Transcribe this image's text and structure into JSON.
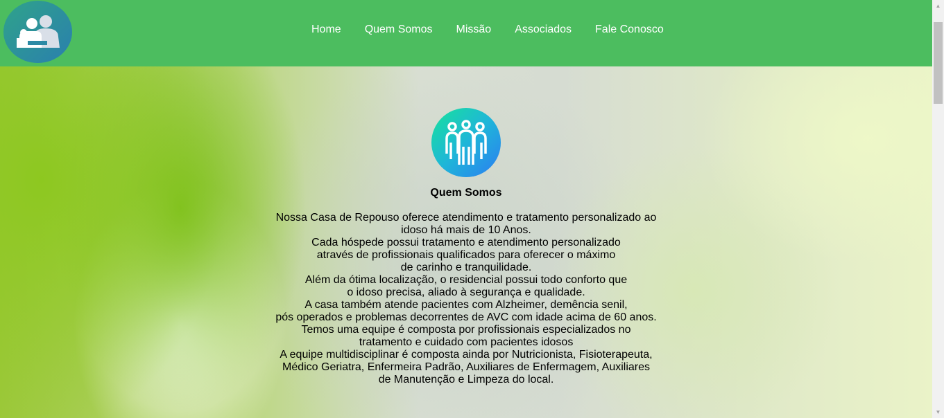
{
  "nav": {
    "items": [
      {
        "label": "Home"
      },
      {
        "label": "Quem Somos"
      },
      {
        "label": "Missão"
      },
      {
        "label": "Associados"
      },
      {
        "label": "Fale Conosco"
      }
    ]
  },
  "section": {
    "title": "Quem Somos",
    "lines": [
      "Nossa Casa de Repouso oferece atendimento e tratamento personalizado ao",
      "idoso há mais de 10 Anos.",
      "Cada hóspede possui tratamento e atendimento personalizado",
      "através de profissionais qualificados para oferecer o máximo",
      "de carinho e tranquilidade.",
      "Além da ótima localização, o residencial possui todo conforto que",
      "o idoso precisa, aliado à segurança e qualidade.",
      "A casa também atende pacientes com Alzheimer, demência senil,",
      "pós operados e problemas decorrentes de AVC com idade acima de 60 anos.",
      "Temos uma equipe é composta por profissionais especializados no",
      "tratamento e cuidado com pacientes idosos",
      "A equipe multidisciplinar é composta ainda por Nutricionista, Fisioterapeuta,",
      "Médico Geriatra, Enfermeira Padrão, Auxiliares de Enfermagem, Auxiliares",
      "de Manutenção e Limpeza do local."
    ]
  },
  "icons": {
    "logo": "family-care-icon",
    "section": "team-icon"
  },
  "colors": {
    "header": "#4cbd5f",
    "nav_text": "#ffffff",
    "logo_gradient_start": "#2fa38a",
    "logo_gradient_end": "#2a7fae",
    "team_gradient_start": "#17e39a",
    "team_gradient_end": "#2b7cf2"
  }
}
